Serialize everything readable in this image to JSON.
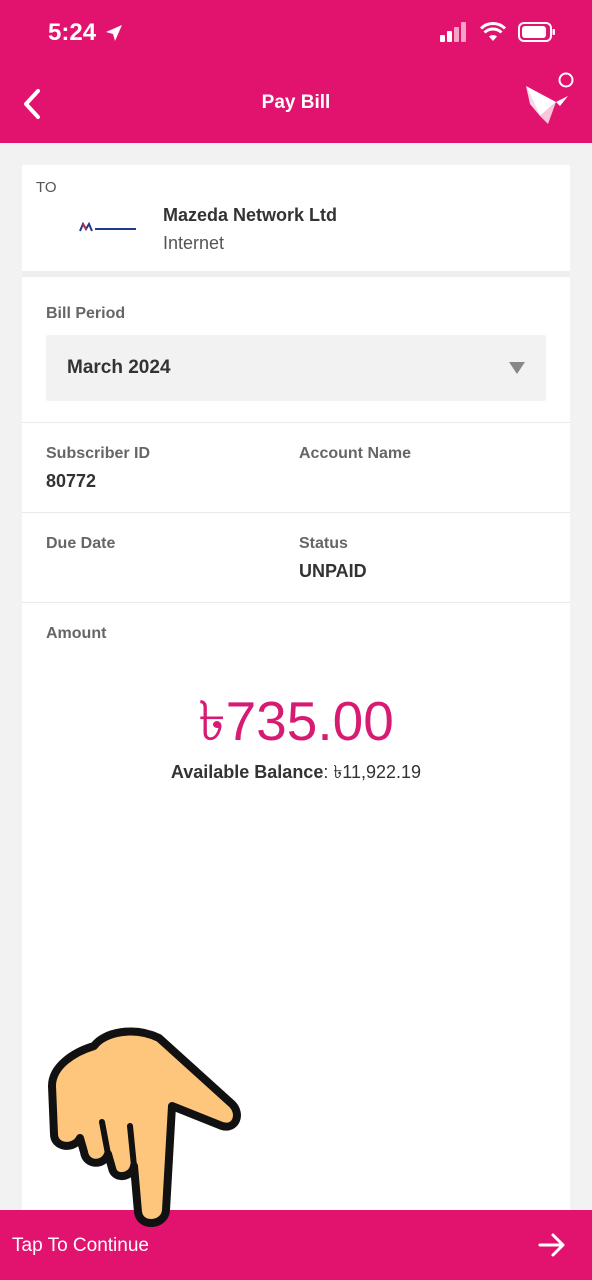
{
  "status_bar": {
    "time": "5:24"
  },
  "header": {
    "title": "Pay Bill"
  },
  "recipient": {
    "to_label": "TO",
    "name": "Mazeda Network Ltd",
    "type": "Internet",
    "logo_text": "Mazeda Networks Limited"
  },
  "bill_period": {
    "label": "Bill Period",
    "selected": "March 2024"
  },
  "details": {
    "subscriber_id_label": "Subscriber ID",
    "subscriber_id": "80772",
    "account_name_label": "Account Name",
    "account_name": "",
    "due_date_label": "Due Date",
    "due_date": "",
    "status_label": "Status",
    "status": "UNPAID"
  },
  "amount": {
    "label": "Amount",
    "value": "৳735.00",
    "balance_label": "Available Balance",
    "balance_value": ": ৳11,922.19"
  },
  "footer": {
    "continue_label": "Tap To Continue"
  },
  "colors": {
    "brand": "#e2136e",
    "amount": "#d81b72"
  },
  "icons": [
    "back-arrow-icon",
    "bkash-bird-logo-icon",
    "location-arrow-icon",
    "signal-icon",
    "wifi-icon",
    "battery-icon",
    "dropdown-arrow-icon",
    "continue-arrow-icon",
    "pointing-hand-icon"
  ]
}
